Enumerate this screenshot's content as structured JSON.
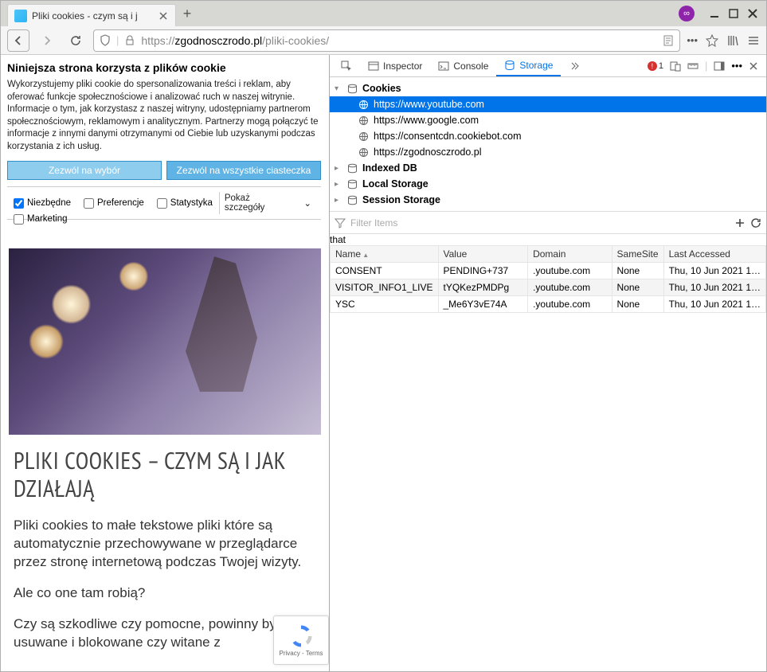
{
  "browser": {
    "tab_title": "Pliki cookies - czym są i j",
    "url_prefix": "https://",
    "url_host": "zgodnosczrodo.pl",
    "url_path": "/pliki-cookies/"
  },
  "consent": {
    "title": "Niniejsza strona korzysta z plików cookie",
    "body": "Wykorzystujemy pliki cookie do spersonalizowania treści i reklam, aby oferować funkcje społecznościowe i analizować ruch w naszej witrynie. Informacje o tym, jak korzystasz z naszej witryny, udostępniamy partnerom społecznościowym, reklamowym i analitycznym. Partnerzy mogą połączyć te informacje z innymi danymi otrzymanymi od Ciebie lub uzyskanymi podczas korzystania z ich usług.",
    "btn_select": "Zezwól na wybór",
    "btn_all": "Zezwól na wszystkie ciasteczka",
    "checks": {
      "necessary": "Niezbędne",
      "preferences": "Preferencje",
      "statistics": "Statystyka",
      "marketing": "Marketing"
    },
    "details": "Pokaż szczegóły"
  },
  "article": {
    "heading": "PLIKI COOKIES – CZYM SĄ I JAK DZIAŁAJĄ",
    "p1": "Pliki cookies to małe tekstowe pliki które są automatycznie przechowywane w przeglądarce przez stronę internetową podczas Twojej wizyty.",
    "p2": "Ale co one tam robią?",
    "p3": "Czy są szkodliwe czy pomocne, powinny być usuwane i blokowane czy witane z"
  },
  "recaptcha": {
    "footer": "Privacy - Terms"
  },
  "devtools": {
    "tabs": {
      "inspector": "Inspector",
      "console": "Console",
      "storage": "Storage"
    },
    "error_count": "1",
    "tree": {
      "cookies": "Cookies",
      "origins": [
        "https://www.youtube.com",
        "https://www.google.com",
        "https://consentcdn.cookiebot.com",
        "https://zgodnosczrodo.pl"
      ],
      "indexeddb": "Indexed DB",
      "localstorage": "Local Storage",
      "sessionstorage": "Session Storage"
    },
    "filter_placeholder": "Filter Items",
    "columns": {
      "name": "Name",
      "value": "Value",
      "domain": "Domain",
      "samesite": "SameSite",
      "lastaccessed": "Last Accessed"
    },
    "rows": [
      {
        "name": "CONSENT",
        "value": "PENDING+737",
        "domain": ".youtube.com",
        "samesite": "None",
        "lastaccessed": "Thu, 10 Jun 2021 1…"
      },
      {
        "name": "VISITOR_INFO1_LIVE",
        "value": "tYQKezPMDPg",
        "domain": ".youtube.com",
        "samesite": "None",
        "lastaccessed": "Thu, 10 Jun 2021 1…"
      },
      {
        "name": "YSC",
        "value": "_Me6Y3vE74A",
        "domain": ".youtube.com",
        "samesite": "None",
        "lastaccessed": "Thu, 10 Jun 2021 1…"
      }
    ]
  }
}
